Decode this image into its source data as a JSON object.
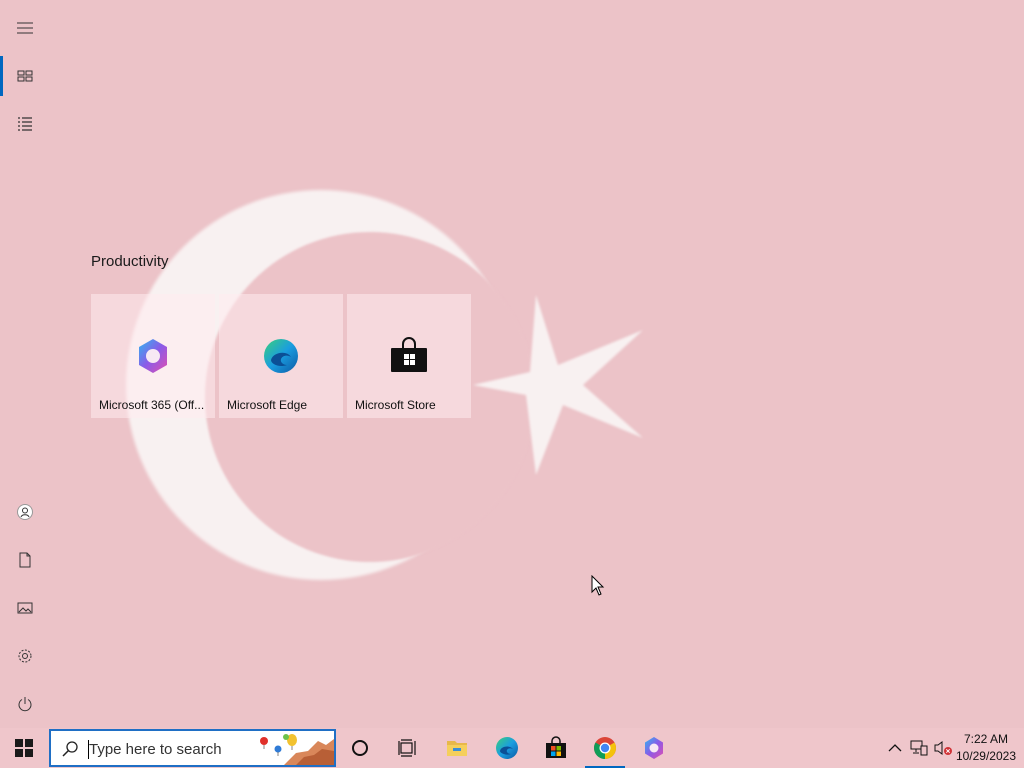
{
  "start_menu": {
    "group_title": "Productivity",
    "tiles": [
      {
        "label": "Microsoft 365 (Off...",
        "icon": "microsoft-365-icon"
      },
      {
        "label": "Microsoft Edge",
        "icon": "edge-icon"
      },
      {
        "label": "Microsoft Store",
        "icon": "store-icon"
      }
    ],
    "rail": [
      "menu-icon",
      "all-tiles-icon",
      "app-list-icon",
      "user-icon",
      "documents-icon",
      "pictures-icon",
      "settings-icon",
      "power-icon"
    ]
  },
  "taskbar": {
    "search_placeholder": "Type here to search",
    "pinned": [
      "cortana-icon",
      "task-view-icon",
      "file-explorer-icon",
      "edge-icon",
      "store-icon",
      "chrome-icon",
      "microsoft-365-icon"
    ],
    "clock": {
      "time": "7:22 AM",
      "date": "10/29/2023"
    }
  },
  "colors": {
    "accent": "#0067c0",
    "background": "#ecc3c8",
    "taskbar": "#efc6cb"
  }
}
